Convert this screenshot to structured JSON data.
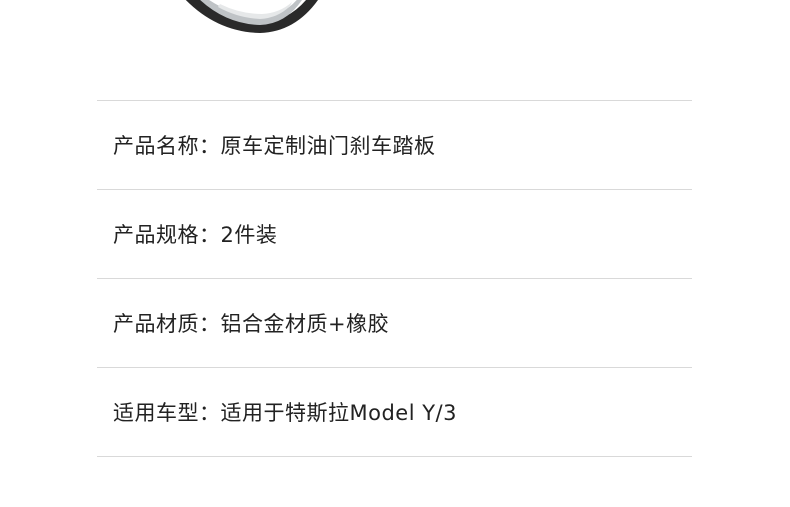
{
  "specs": [
    {
      "label": "产品名称：",
      "value": "原车定制油门刹车踏板"
    },
    {
      "label": "产品规格：",
      "value": "2件装"
    },
    {
      "label": "产品材质：",
      "value": "铝合金材质+橡胶"
    },
    {
      "label": "适用车型：",
      "value": "适用于特斯拉Model Y/3"
    }
  ],
  "colors": {
    "text": "#222222",
    "divider": "#d9d9d9"
  }
}
